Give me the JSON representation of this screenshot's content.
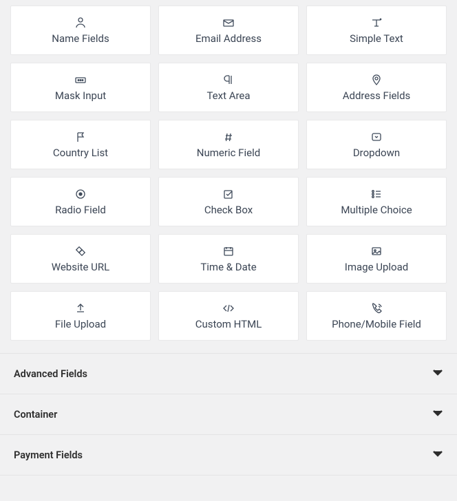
{
  "fields": [
    {
      "id": "name-fields",
      "label": "Name Fields",
      "icon": "user"
    },
    {
      "id": "email-address",
      "label": "Email Address",
      "icon": "mail"
    },
    {
      "id": "simple-text",
      "label": "Simple Text",
      "icon": "text"
    },
    {
      "id": "mask-input",
      "label": "Mask Input",
      "icon": "mask"
    },
    {
      "id": "text-area",
      "label": "Text Area",
      "icon": "paragraph"
    },
    {
      "id": "address-fields",
      "label": "Address Fields",
      "icon": "pin"
    },
    {
      "id": "country-list",
      "label": "Country List",
      "icon": "flag"
    },
    {
      "id": "numeric-field",
      "label": "Numeric Field",
      "icon": "hash"
    },
    {
      "id": "dropdown",
      "label": "Dropdown",
      "icon": "dropdown"
    },
    {
      "id": "radio-field",
      "label": "Radio Field",
      "icon": "radio"
    },
    {
      "id": "check-box",
      "label": "Check Box",
      "icon": "checkbox"
    },
    {
      "id": "multiple-choice",
      "label": "Multiple Choice",
      "icon": "list"
    },
    {
      "id": "website-url",
      "label": "Website URL",
      "icon": "link"
    },
    {
      "id": "time-date",
      "label": "Time & Date",
      "icon": "calendar"
    },
    {
      "id": "image-upload",
      "label": "Image Upload",
      "icon": "image"
    },
    {
      "id": "file-upload",
      "label": "File Upload",
      "icon": "upload"
    },
    {
      "id": "custom-html",
      "label": "Custom HTML",
      "icon": "code"
    },
    {
      "id": "phone-mobile",
      "label": "Phone/Mobile Field",
      "icon": "phone"
    }
  ],
  "accordion": [
    {
      "id": "advanced-fields",
      "title": "Advanced Fields"
    },
    {
      "id": "container",
      "title": "Container"
    },
    {
      "id": "payment-fields",
      "title": "Payment Fields"
    }
  ]
}
